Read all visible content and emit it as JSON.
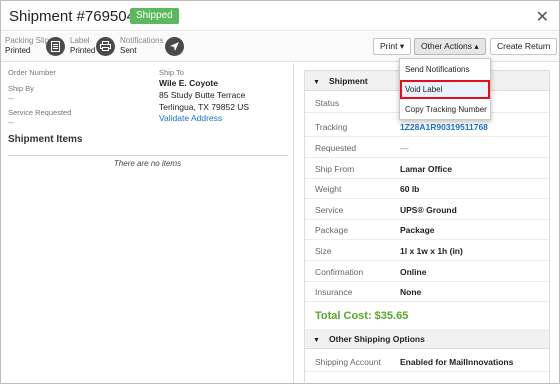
{
  "header": {
    "title": "Shipment #76950499",
    "status_badge": "Shipped",
    "close_icon": "close-icon"
  },
  "toolbar": {
    "packing_slip": {
      "label": "Packing Slip",
      "value": "Printed",
      "icon": "document-icon"
    },
    "label": {
      "label": "Label",
      "value": "Printed",
      "icon": "printer-icon"
    },
    "notifications": {
      "label": "Notifications",
      "value": "Sent",
      "icon": "send-icon"
    },
    "print_button": "Print ▾",
    "other_actions_button": "Other Actions ▴",
    "create_return_button": "Create Return"
  },
  "dropdown": {
    "items": [
      "Send Notifications",
      "Void Label",
      "Copy Tracking Number"
    ],
    "highlighted_index": 1,
    "highlight_color": "#e0101a"
  },
  "details": {
    "order_number_label": "Order Number",
    "ship_by_label": "Ship By",
    "ship_by_value": "--",
    "service_requested_label": "Service Requested",
    "service_requested_value": "--",
    "ship_to_label": "Ship To",
    "ship_to_name": "Wile E. Coyote",
    "ship_to_street": "85 Study Butte Terrace",
    "ship_to_city": "Terlingua, TX 79852 US",
    "validate_address_link": "Validate Address"
  },
  "items": {
    "title": "Shipment Items",
    "empty_text": "There are no items"
  },
  "shipment_panel": {
    "title": "Shipment",
    "rows": [
      {
        "key": "Status",
        "value": ""
      },
      {
        "key": "Tracking",
        "value": "1Z28A1R90319511768"
      },
      {
        "key": "Requested",
        "value": "—"
      },
      {
        "key": "Ship From",
        "value": "Lamar Office"
      },
      {
        "key": "Weight",
        "value": "60 lb"
      },
      {
        "key": "Service",
        "value": "UPS® Ground"
      },
      {
        "key": "Package",
        "value": "Package"
      },
      {
        "key": "Size",
        "value": "1l x 1w x 1h (in)"
      },
      {
        "key": "Confirmation",
        "value": "Online"
      },
      {
        "key": "Insurance",
        "value": "None"
      }
    ],
    "total_cost": "Total Cost: $35.65",
    "total_color": "#5aa52e"
  },
  "other_options_panel": {
    "title": "Other Shipping Options",
    "rows": [
      {
        "key": "Shipping Account",
        "value": "Enabled for MailInnovations"
      }
    ]
  },
  "colors": {
    "badge": "#5cb85c",
    "link": "#1a73c8"
  }
}
